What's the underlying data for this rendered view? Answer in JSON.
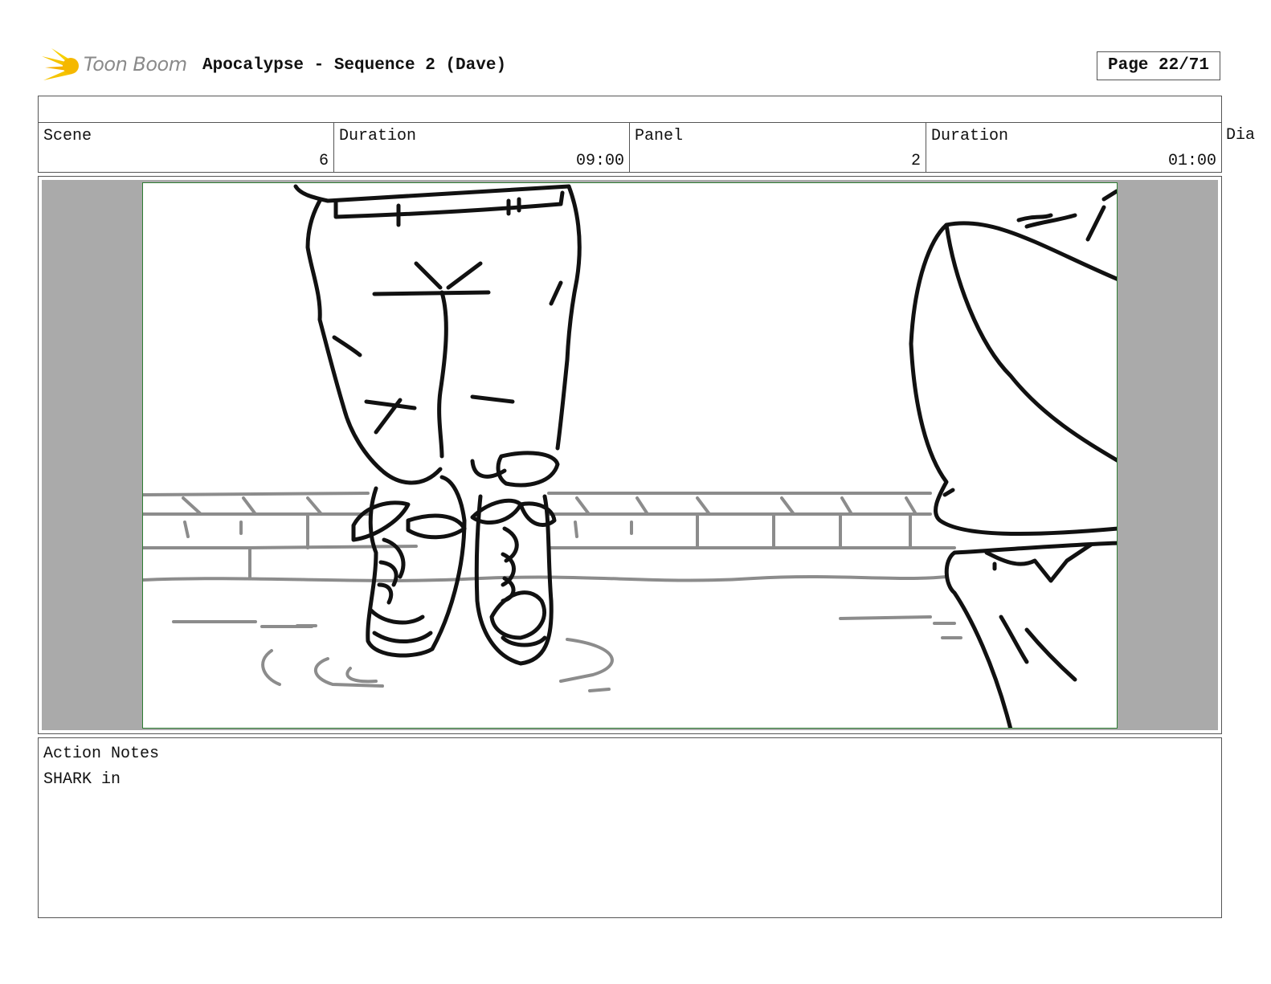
{
  "header": {
    "logo_name": "Toon Boom",
    "title": "Apocalypse - Sequence 2 (Dave)",
    "page": "Page 22/71"
  },
  "info": {
    "scene_label": "Scene",
    "scene_value": "6",
    "scene_duration_label": "Duration",
    "scene_duration_value": "09:00",
    "panel_label": "Panel",
    "panel_value": "2",
    "panel_duration_label": "Duration",
    "panel_duration_value": "01:00",
    "dialogue_label": "Dia"
  },
  "notes": {
    "label": "Action Notes",
    "text": "SHARK in"
  },
  "colors": {
    "logo_yellow": "#f5c400",
    "panel_border": "#2e7d32",
    "panel_margin": "#aaaaaa"
  }
}
